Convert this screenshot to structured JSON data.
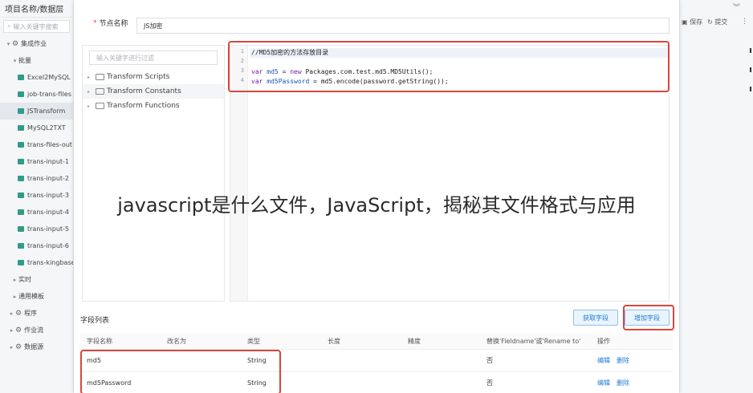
{
  "left_panel": {
    "title": "项目名称/数据层",
    "search_placeholder": "输入关键字搜索",
    "nodes": [
      {
        "label": "集成作业",
        "type": "group",
        "caret": "▾"
      },
      {
        "label": "批量",
        "type": "group",
        "caret": "▾"
      },
      {
        "label": "Excel2MySQL",
        "type": "file"
      },
      {
        "label": "job-trans-files",
        "type": "file"
      },
      {
        "label": "JSTransform",
        "type": "file",
        "selected": true
      },
      {
        "label": "MySQL2TXT",
        "type": "file"
      },
      {
        "label": "trans-files-out",
        "type": "file"
      },
      {
        "label": "trans-input-1",
        "type": "file"
      },
      {
        "label": "trans-input-2",
        "type": "file"
      },
      {
        "label": "trans-input-3",
        "type": "file"
      },
      {
        "label": "trans-input-4",
        "type": "file"
      },
      {
        "label": "trans-input-5",
        "type": "file"
      },
      {
        "label": "trans-input-6",
        "type": "file"
      },
      {
        "label": "trans-kingbase",
        "type": "file"
      },
      {
        "label": "实时",
        "type": "group",
        "caret": "▸"
      },
      {
        "label": "通用模板",
        "type": "group",
        "caret": "▸"
      },
      {
        "label": "程序",
        "type": "root",
        "caret": "▸"
      },
      {
        "label": "作业流",
        "type": "root",
        "caret": "▸"
      },
      {
        "label": "数据源",
        "type": "root",
        "caret": "▸"
      }
    ]
  },
  "right_strip": {
    "save_label": "保存",
    "submit_label": "提交"
  },
  "dialog": {
    "node_name_label": "节点名称",
    "node_name_value": "JS加密",
    "function_search_placeholder": "输入关键字进行过滤",
    "function_tree": [
      "Transform Scripts",
      "Transform Constants",
      "Transform Functions"
    ],
    "code_line_numbers": [
      "1",
      "2",
      "3",
      "4"
    ],
    "code_line1": "//MD5加密的方法存放目录",
    "code_line3_kw": "var",
    "code_line3_var": "md5",
    "code_line3_mid": " = ",
    "code_line3_new": "new",
    "code_line3_rest": " Packages.com.test.md5.MD5Utils();",
    "code_line4_kw": "var",
    "code_line4_var": "md5Password",
    "code_line4_rest": " = md5.encode(password.getString());",
    "fields_title": "字段列表",
    "get_fields_label": "获取字段",
    "add_field_label": "增加字段",
    "table_headers": [
      "字段名称",
      "改名为",
      "类型",
      "长度",
      "精度",
      "替换'Fieldname'或'Rename to'",
      "操作"
    ],
    "rows": [
      {
        "name": "md5",
        "rename": "",
        "type": "String",
        "length": "",
        "precision": "",
        "replace": "否",
        "edit": "编辑",
        "delete": "删除"
      },
      {
        "name": "md5Password",
        "rename": "",
        "type": "String",
        "length": "",
        "precision": "",
        "replace": "否",
        "edit": "编辑",
        "delete": "删除"
      }
    ]
  },
  "overlay_caption": "javascript是什么文件，JavaScript，揭秘其文件格式与应用",
  "colors": {
    "accent": "#1f7ad6",
    "highlight_box": "#d9463c",
    "file_icon": "#2e9c8c"
  }
}
